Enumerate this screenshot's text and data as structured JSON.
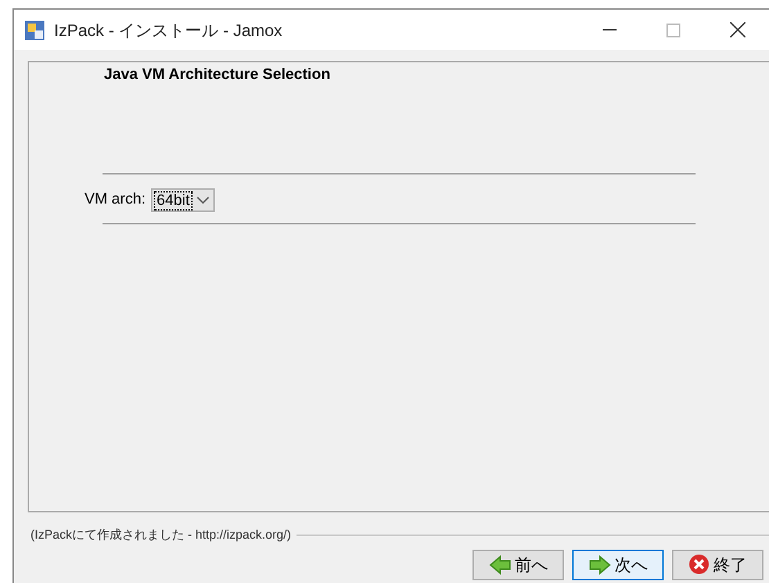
{
  "window": {
    "title": "IzPack - インストール - Jamox"
  },
  "panel": {
    "heading": "Java VM Architecture Selection",
    "field_label": "VM arch:",
    "select": {
      "value": "64bit"
    }
  },
  "footer": {
    "credit": "(IzPackにて作成されました - http://izpack.org/)"
  },
  "buttons": [
    {
      "kind": "back",
      "label": "前へ",
      "focused": false
    },
    {
      "kind": "next",
      "label": "次へ",
      "focused": true
    },
    {
      "kind": "quit",
      "label": "終了",
      "focused": false
    }
  ]
}
